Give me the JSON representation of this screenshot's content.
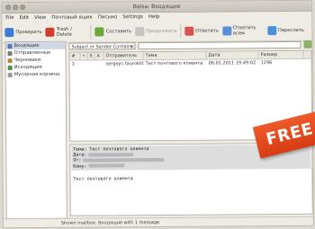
{
  "window": {
    "title": "Balsa: Входящие"
  },
  "menu": [
    "File",
    "Edit",
    "View",
    "Почтовый ящик",
    "Письмо",
    "Settings",
    "Help"
  ],
  "toolbar": [
    {
      "label": "Проверить",
      "icon": "check-mail-icon",
      "color": "#3d7bd5",
      "disabled": false
    },
    {
      "label": "Trash / Delete",
      "icon": "trash-icon",
      "color": "#d33a2c",
      "disabled": false
    },
    {
      "label": "Составить",
      "icon": "compose-icon",
      "color": "#6aa83a",
      "disabled": false
    },
    {
      "label": "Продолжить",
      "icon": "continue-icon",
      "color": "#8a8a8a",
      "disabled": true
    },
    {
      "label": "Ответить",
      "icon": "reply-icon",
      "color": "#d9534f",
      "disabled": false
    },
    {
      "label": "Ответить всем",
      "icon": "reply-all-icon",
      "color": "#5b8fd3",
      "disabled": false
    },
    {
      "label": "Переслать",
      "icon": "forward-icon",
      "color": "#4a90d9",
      "disabled": false
    }
  ],
  "folders": [
    {
      "name": "Входящие",
      "color": "#4f7bb5",
      "active": true
    },
    {
      "name": "Отправленные",
      "color": "#7a7a7a",
      "active": false
    },
    {
      "name": "Черновики",
      "color": "#b08a3c",
      "active": false
    },
    {
      "name": "Исходящие",
      "color": "#4a8f4a",
      "active": false
    },
    {
      "name": "Мусорная корзина",
      "color": "#999999",
      "active": false
    }
  ],
  "search": {
    "field": "Subject or Sender Contains:"
  },
  "list": {
    "columns": [
      "#",
      "•",
      "S",
      "A",
      "Отправитель",
      "Тема",
      "Дата",
      "Размер"
    ],
    "rows": [
      {
        "num": "1",
        "sender": "sergeyc.tauroklit",
        "subject": "Тест почтового клиента",
        "date": "06.01.2011 19:49:02",
        "size": "1296"
      }
    ]
  },
  "preview": {
    "subject": "Тема: Тест почтового клиента",
    "date": "Дата:",
    "from": "От:",
    "to": "Кому:",
    "body": "Тест почтового клиента"
  },
  "status": "Shown mailbox: Входящие with 1 message",
  "badge": "FREE"
}
